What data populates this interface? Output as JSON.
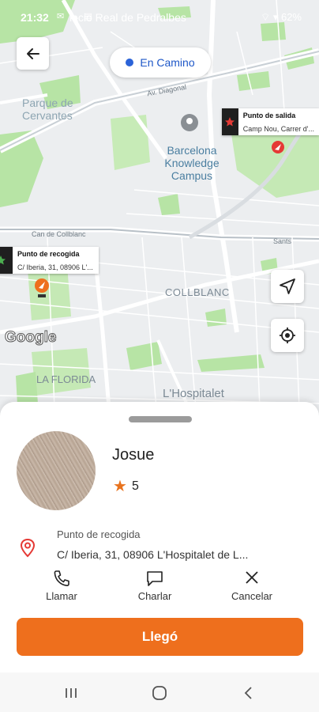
{
  "status_bar": {
    "time": "21:32",
    "notifications": "✉ ☁ ▤ ·",
    "battery": "62%"
  },
  "map": {
    "labels": {
      "palau": "lacio Real de Pedralbes",
      "parque": "Parque de Cervantes",
      "diagonal": "Av. Diagonal",
      "knowledge": "Barcelona Knowledge Campus",
      "collblanc_street": "Can de Collblanc",
      "collblanc": "COLLBLANC",
      "florida": "LA FLORIDA",
      "hospitalet": "L'Hospitalet",
      "sants": "Sants"
    },
    "google": "Google",
    "callouts": {
      "departure": {
        "title": "Punto de salida",
        "subtitle": "Camp Nou, Carrer d'..."
      },
      "pickup": {
        "title": "Punto de recogida",
        "subtitle": "C/ Iberia, 31, 08906 L'..."
      }
    }
  },
  "top": {
    "status_label": "En Camino"
  },
  "driver": {
    "name": "Josue",
    "rating": "5"
  },
  "pickup": {
    "title": "Punto de recogida",
    "address": "C/ Iberia, 31, 08906 L'Hospitalet de L..."
  },
  "actions": {
    "call": "Llamar",
    "chat": "Charlar",
    "cancel": "Cancelar"
  },
  "arrive_button": "Llegó",
  "colors": {
    "accent": "#ee6f1d",
    "status_blue": "#1f58c8",
    "map_green": "#b7e4a5",
    "pin_red": "#e53935"
  }
}
